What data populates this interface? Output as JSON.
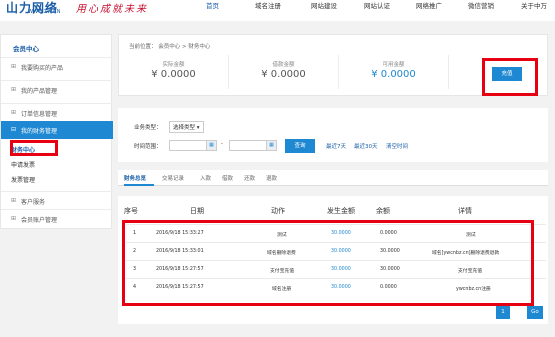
{
  "header": {
    "logo_text": "山力网络",
    "logo_url": "WWW.ZW.CN",
    "slogan": "用心成就未来",
    "nav": [
      "首页",
      "域名注册",
      "网站建设",
      "网站认证",
      "网络推广",
      "微信营销",
      "关于中万"
    ]
  },
  "sidebar": {
    "title": "会员中心",
    "items": [
      {
        "prefix": "⊞",
        "label": "我要购买的产品"
      },
      {
        "prefix": "⊞",
        "label": "我的产品管理"
      },
      {
        "prefix": "⊞",
        "label": "订单信息管理"
      },
      {
        "prefix": "⊟",
        "label": "我的财务管理"
      }
    ],
    "sub_items": [
      "财务中心",
      "申请发票",
      "发票管理"
    ],
    "items_after": [
      {
        "prefix": "⊞",
        "label": "客户服务"
      },
      {
        "prefix": "⊞",
        "label": "会员账户管理"
      }
    ]
  },
  "breadcrumb": "当前位置： 会员中心 > 财务中心",
  "balances": [
    {
      "label": "实际金额",
      "value": "¥ 0.0000"
    },
    {
      "label": "借款金额",
      "value": "¥ 0.0000"
    },
    {
      "label": "可用金额",
      "value": "¥ 0.0000"
    }
  ],
  "recharge_button": "充值",
  "filter": {
    "type_label": "业务类型：",
    "type_select": "选择类型 ▾",
    "time_label": "时间范围：",
    "dash": "-",
    "query_button": "查询",
    "links": [
      "最近7天",
      "最近30天",
      "清空时间"
    ]
  },
  "tabs": [
    "财务总览",
    "交易记录",
    "入款",
    "借款",
    "还款",
    "退款"
  ],
  "table": {
    "headers": [
      "序号",
      "日期",
      "动作",
      "发生金额",
      "余额",
      "详情"
    ],
    "rows": [
      [
        "1",
        "2016/9/18 15:33:27",
        "测试",
        "30.0000",
        "0.0000",
        "测试"
      ],
      [
        "2",
        "2016/9/18 15:33:01",
        "域名删除退费",
        "30.0000",
        "30.0000",
        "域名[ywcnbz.cn]删除退费退款"
      ],
      [
        "3",
        "2016/9/18 15:27:57",
        "支付宝充值",
        "30.0000",
        "30.0000",
        "支付宝充值"
      ],
      [
        "4",
        "2016/9/18 15:27:57",
        "域名注册",
        "30.0000",
        "0.0000",
        "ywcnbz.cn注册"
      ]
    ]
  },
  "pagination": {
    "page": "1",
    "go": "Go"
  },
  "colors": {
    "accent": "#1e88d2",
    "highlight": "#e60012"
  }
}
